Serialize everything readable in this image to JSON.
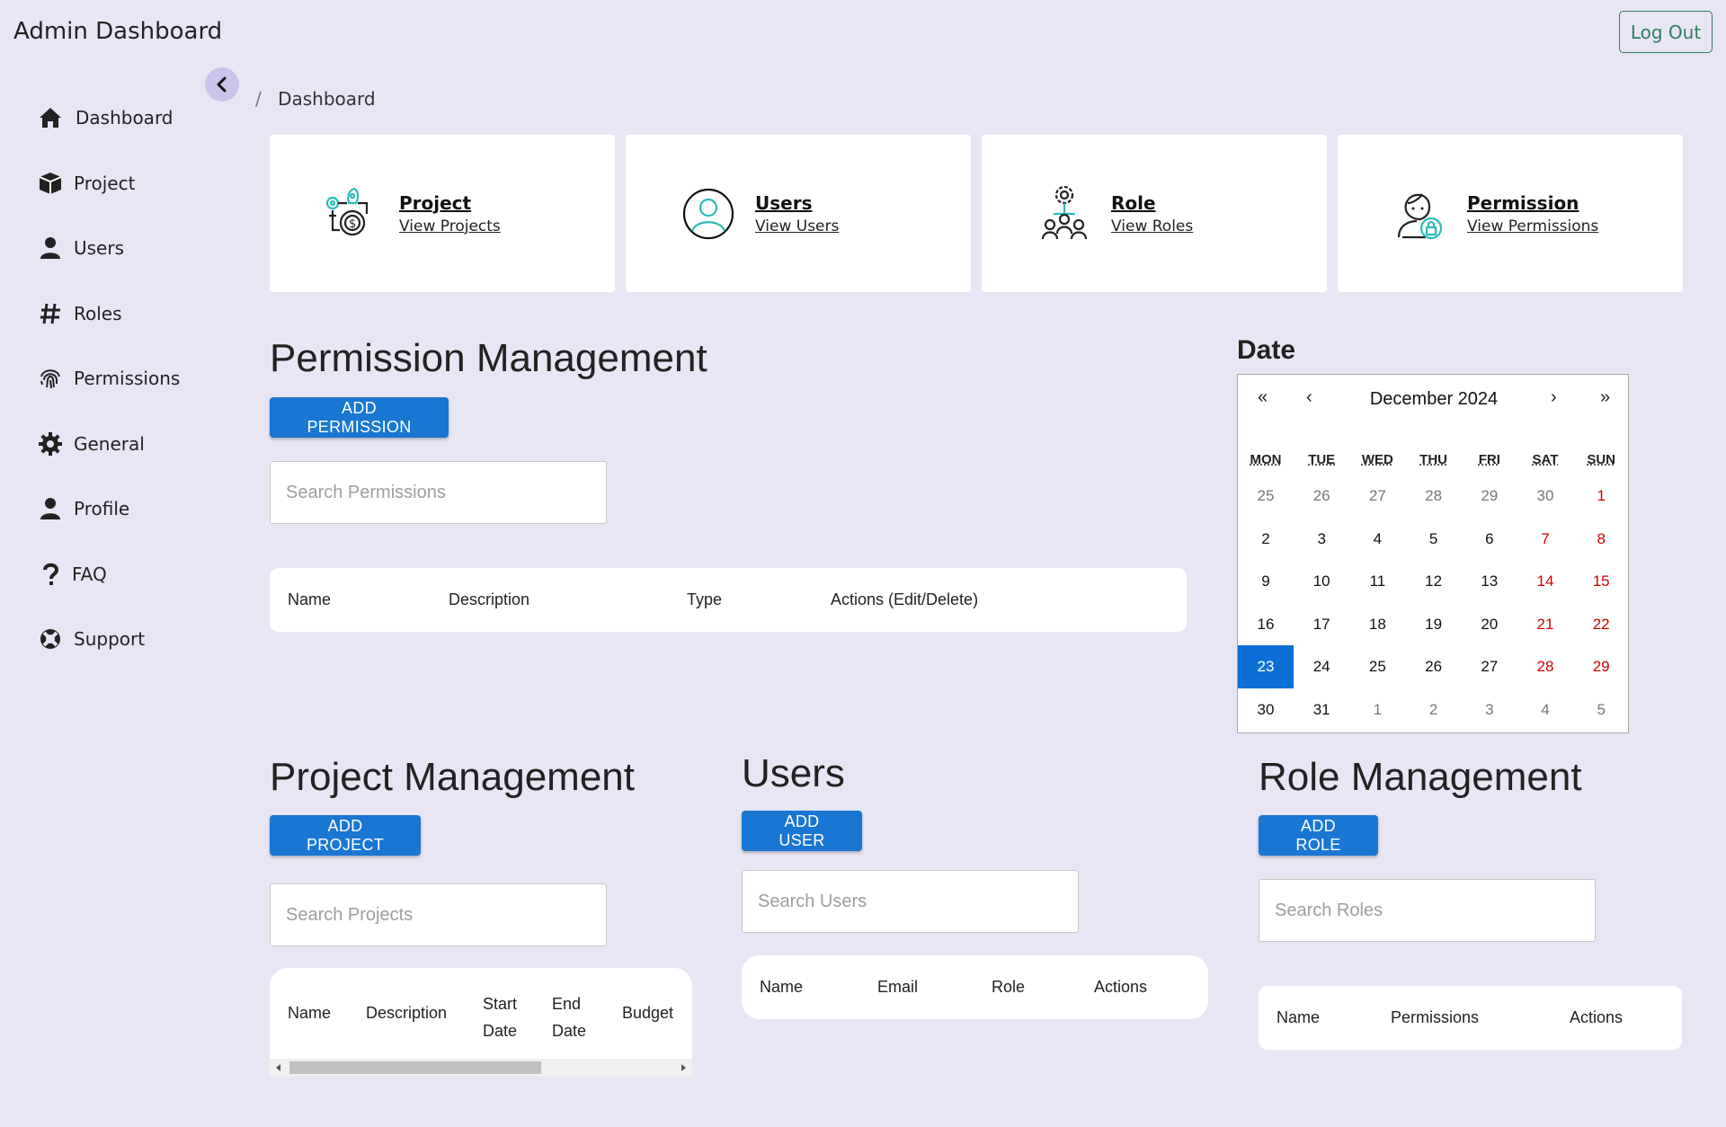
{
  "app": {
    "title": "Admin Dashboard",
    "logout_label": "Log Out"
  },
  "sidebar": {
    "items": [
      {
        "label": "Dashboard",
        "icon": "home-icon"
      },
      {
        "label": "Project",
        "icon": "cube-icon"
      },
      {
        "label": "Users",
        "icon": "user-icon"
      },
      {
        "label": "Roles",
        "icon": "hashtag-icon"
      },
      {
        "label": "Permissions",
        "icon": "fingerprint-icon"
      },
      {
        "label": "General",
        "icon": "gear-icon"
      },
      {
        "label": "Profile",
        "icon": "user-icon"
      },
      {
        "label": "FAQ",
        "icon": "question-icon"
      },
      {
        "label": "Support",
        "icon": "lifebuoy-icon"
      }
    ]
  },
  "breadcrumb": {
    "separator": "/",
    "current": "Dashboard"
  },
  "cards": [
    {
      "title": "Project",
      "link": "View Projects",
      "icon": "project-gears-icon"
    },
    {
      "title": "Users",
      "link": "View Users",
      "icon": "user-circle-icon"
    },
    {
      "title": "Role",
      "link": "View Roles",
      "icon": "role-hierarchy-icon"
    },
    {
      "title": "Permission",
      "link": "View Permissions",
      "icon": "permission-person-lock-icon"
    }
  ],
  "permission_mgmt": {
    "title": "Permission Management",
    "add_label": "ADD PERMISSION",
    "search_placeholder": "Search Permissions",
    "columns": [
      "Name",
      "Description",
      "Type",
      "Actions (Edit/Delete)"
    ]
  },
  "calendar": {
    "label": "Date",
    "month": "December 2024",
    "nav": {
      "prev_year": "«",
      "prev_month": "‹",
      "next_month": "›",
      "next_year": "»"
    },
    "weekdays": [
      "MON",
      "TUE",
      "WED",
      "THU",
      "FRI",
      "SAT",
      "SUN"
    ],
    "weeks": [
      [
        "25",
        "26",
        "27",
        "28",
        "29",
        "30",
        "1"
      ],
      [
        "2",
        "3",
        "4",
        "5",
        "6",
        "7",
        "8"
      ],
      [
        "9",
        "10",
        "11",
        "12",
        "13",
        "14",
        "15"
      ],
      [
        "16",
        "17",
        "18",
        "19",
        "20",
        "21",
        "22"
      ],
      [
        "23",
        "24",
        "25",
        "26",
        "27",
        "28",
        "29"
      ],
      [
        "30",
        "31",
        "1",
        "2",
        "3",
        "4",
        "5"
      ]
    ],
    "selected": "23",
    "colors": {
      "selected_bg": "#0b6fd6",
      "weekend": "#d00000",
      "outside_month": "#777777"
    }
  },
  "project_mgmt": {
    "title": "Project Management",
    "add_label": "ADD PROJECT",
    "search_placeholder": "Search Projects",
    "columns": [
      "Name",
      "Description",
      "Start Date",
      "End Date",
      "Budget"
    ]
  },
  "users_mgmt": {
    "title": "Users",
    "add_label": "ADD USER",
    "search_placeholder": "Search Users",
    "columns": [
      "Name",
      "Email",
      "Role",
      "Actions"
    ]
  },
  "role_mgmt": {
    "title": "Role Management",
    "add_label": "ADD ROLE",
    "search_placeholder": "Search Roles",
    "columns": [
      "Name",
      "Permissions",
      "Actions"
    ]
  },
  "theme": {
    "background": "#e8e6f4",
    "primary": "#1976d2",
    "logout": "#2e7d61",
    "collapse_bg": "#c9c5ea"
  }
}
